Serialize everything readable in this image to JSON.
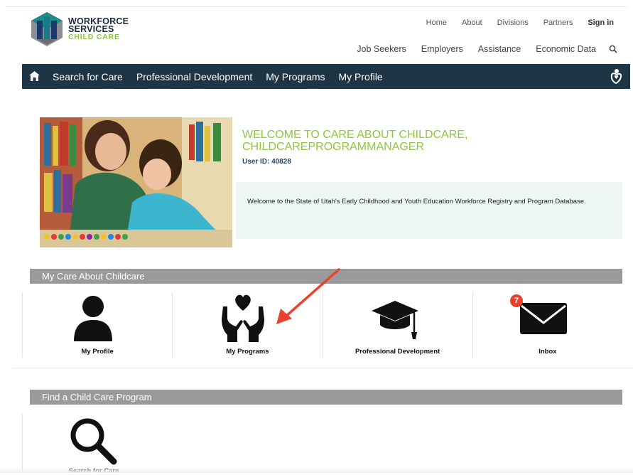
{
  "logo": {
    "line1": "WORKFORCE",
    "line2": "SERVICES",
    "line3": "CHILD CARE"
  },
  "utility_nav": {
    "home": "Home",
    "about": "About",
    "divisions": "Divisions",
    "partners": "Partners",
    "signin": "Sign in"
  },
  "main_nav": {
    "job_seekers": "Job Seekers",
    "employers": "Employers",
    "assistance": "Assistance",
    "economic_data": "Economic Data"
  },
  "navbar": {
    "items": [
      "Search for Care",
      "Professional Development",
      "My Programs",
      "My Profile"
    ]
  },
  "welcome": {
    "title": "WELCOME TO CARE ABOUT CHILDCARE, CHILDCAREPROGRAMMANAGER",
    "user_id": "User ID: 40828",
    "message": "Welcome to the State of Utah's Early Childhood and Youth Education Workforce Registry and Program Database."
  },
  "my_care": {
    "heading": "My Care About Childcare",
    "tiles": [
      "My Profile",
      "My Programs",
      "Professional Development",
      "Inbox"
    ],
    "inbox_count": "7"
  },
  "find_program": {
    "heading": "Find a Child Care Program",
    "tile": "Search for Care"
  },
  "colors": {
    "navbar": "#1e3546",
    "accent_green": "#8dc63f",
    "section_bar": "#9a9a9a",
    "badge": "#e8432d",
    "arrow": "#e8432d"
  }
}
